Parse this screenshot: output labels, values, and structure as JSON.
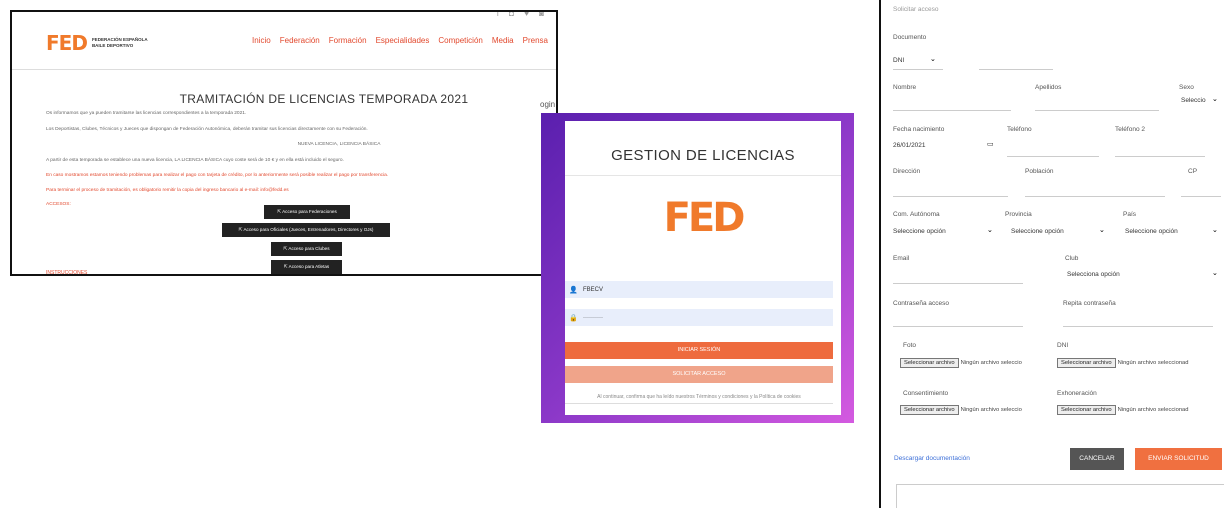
{
  "webpage": {
    "logo": "FED",
    "logo_line1": "FEDERACIÓN ESPAÑOLA",
    "logo_line2": "BAILE DEPORTIVO",
    "nav": [
      "Inicio",
      "Federación",
      "Formación",
      "Especialidades",
      "Competición",
      "Media",
      "Prensa"
    ],
    "title": "TRAMITACIÓN DE LICENCIAS TEMPORADA 2021",
    "p1": "Os informamos que ya pueden tramitarse las licencias correspondientes a la temporada 2021.",
    "p2": "Los Deportistas, Clubes, Técnicos y Jueces que dispongan de Federación Autonómica, deberán tramitar sus licencias directamente con su Federación.",
    "p3": "NUEVA LICENCIA, LICENCIA BÁSICA",
    "p4": "A partir de esta temporada se establece una nueva licencia, LA LICENCIA BÁSICA cuyo coste será de 10 € y en ella está incluido el seguro.",
    "p5": "En caso mostramos estamos teniendo problemas para realizar el pago con tarjeta de crédito, por lo anteriormente será posible realizar el pago por transferencia.",
    "p6": "Para terminar el proceso de tramitación, es obligatorio remitir la copia del ingreso bancario al e-mail: info@fedd.es",
    "accesos": "ACCESOS:",
    "buttons": [
      "Acceso para Federaciones",
      "Acceso para Oficiales (Jueces, Entrenadores, Directores y OJs)",
      "Acceso para Clubes",
      "Acceso para Atletas"
    ],
    "instrucciones": "INSTRUCCIONES"
  },
  "login": {
    "top_label": "ogin",
    "heading": "GESTION DE LICENCIAS",
    "logo": "FED",
    "user_value": "FBECV",
    "password_value": "··········",
    "login_button": "INICIAR SESIÓN",
    "request_button": "SOLICITAR ACCESO",
    "terms": "Al continuar, confirma que ha leído nuestros Términos y condiciones y la Política de cookies"
  },
  "form": {
    "header_partial": "Solicitar acceso",
    "documento_label": "Documento",
    "documento_value": "DNI",
    "nombre_label": "Nombre",
    "apellidos_label": "Apellidos",
    "sexo_label": "Sexo",
    "sexo_value": "Seleccio",
    "fecha_label": "Fecha nacimiento",
    "fecha_value": "26/01/2021",
    "telefono_label": "Teléfono",
    "telefono2_label": "Teléfono 2",
    "direccion_label": "Dirección",
    "poblacion_label": "Población",
    "cp_label": "CP",
    "com_label": "Com. Autónoma",
    "com_value": "Seleccione opción",
    "provincia_label": "Provincia",
    "provincia_value": "Seleccione opción",
    "pais_label": "País",
    "pais_value": "Seleccione opción",
    "email_label": "Email",
    "club_label": "Club",
    "club_value": "Selecciona opción",
    "pass_label": "Contraseña acceso",
    "pass2_label": "Repita contraseña",
    "foto_label": "Foto",
    "dni_label": "DNI",
    "consent_label": "Consentimiento",
    "exon_label": "Exhoneración",
    "file_button": "Seleccionar archivo",
    "file_none_short": "Ningún archivo seleccio",
    "file_none_long": "Ningún archivo seleccionad",
    "download_link": "Descargar documentación",
    "cancel_button": "CANCELAR",
    "send_button": "ENVIAR SOLICITUD"
  }
}
